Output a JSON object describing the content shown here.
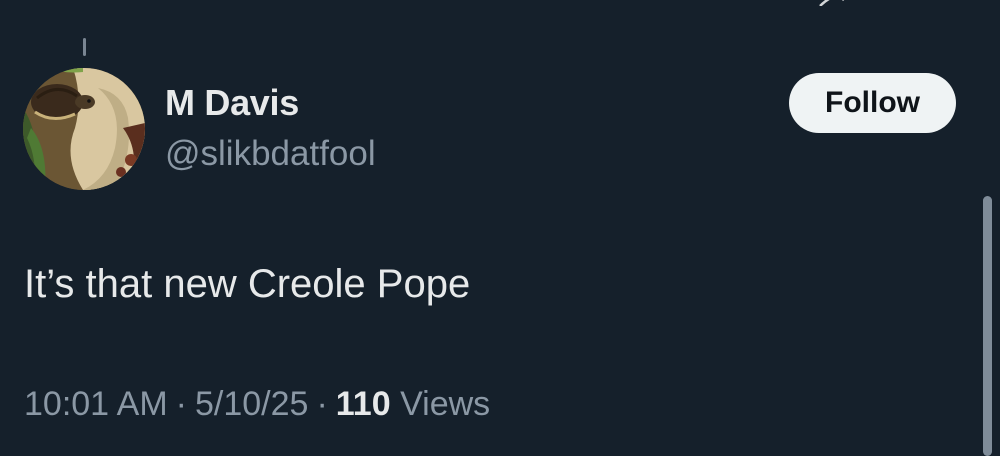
{
  "tweet": {
    "author": {
      "display_name": "M Davis",
      "handle": "@slikbdatfool",
      "avatar_icon": "avatar-turtle"
    },
    "follow_label": "Follow",
    "text": "It’s that new Creole Pope",
    "meta": {
      "time": "10:01 AM",
      "separator": "·",
      "date": "5/10/25",
      "views_count": "110",
      "views_label": "Views"
    }
  },
  "colors": {
    "background": "#15202b",
    "primary_text": "#e7e9ea",
    "secondary_text": "#8b98a5",
    "follow_bg": "#eff3f4",
    "follow_text": "#0f1419"
  }
}
